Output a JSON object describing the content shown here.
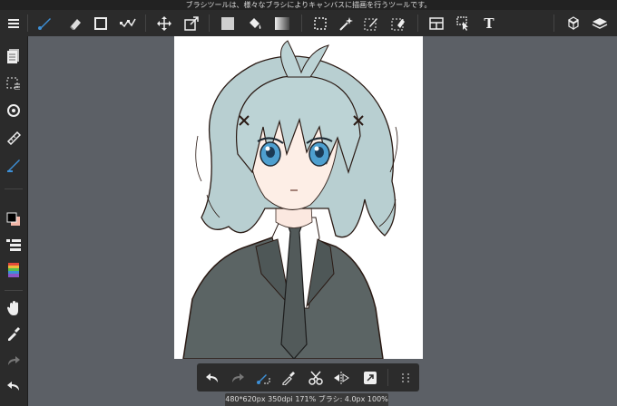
{
  "hint": {
    "text": "ブラシツールは、様々なブラシによりキャンバスに描画を行うツールです。"
  },
  "toolbar": {
    "tools": [
      {
        "name": "menu-icon",
        "selected": false
      },
      {
        "name": "brush-tool-icon",
        "selected": true
      },
      {
        "name": "eraser-tool-icon",
        "selected": false
      },
      {
        "name": "shape-tool-icon",
        "selected": false
      },
      {
        "name": "edit-tool-icon",
        "selected": false
      },
      {
        "name": "move-tool-icon",
        "selected": false
      },
      {
        "name": "transform-tool-icon",
        "selected": false
      },
      {
        "name": "fill-color-icon",
        "selected": false
      },
      {
        "name": "bucket-tool-icon",
        "selected": false
      },
      {
        "name": "gradient-tool-icon",
        "selected": false
      },
      {
        "name": "select-tool-icon",
        "selected": false
      },
      {
        "name": "magic-wand-icon",
        "selected": false
      },
      {
        "name": "select-pen-icon",
        "selected": false
      },
      {
        "name": "select-eraser-icon",
        "selected": false
      },
      {
        "name": "frame-divide-icon",
        "selected": false
      },
      {
        "name": "operation-tool-icon",
        "selected": false
      },
      {
        "name": "text-tool-icon",
        "selected": false
      },
      {
        "name": "material-icon",
        "selected": false
      },
      {
        "name": "layers-icon",
        "selected": false
      }
    ],
    "text_tool_label": "T"
  },
  "sidebar": {
    "items": [
      {
        "name": "page-manager-icon"
      },
      {
        "name": "selection-layer-icon"
      },
      {
        "name": "snap-icon"
      },
      {
        "name": "ruler-icon"
      },
      {
        "name": "brush-settings-icon"
      },
      {
        "name": "color-swatch-icon"
      },
      {
        "name": "layer-property-icon"
      },
      {
        "name": "color-palette-icon"
      },
      {
        "name": "hand-tool-icon"
      },
      {
        "name": "eyedropper-icon"
      },
      {
        "name": "redo-icon"
      },
      {
        "name": "undo-icon"
      }
    ],
    "colors": {
      "primary": "#000000",
      "secondary": "#f4b7a8",
      "accent": "#3d8fd6"
    }
  },
  "canvas": {
    "background": "#5c6066",
    "paper_color": "#ffffff",
    "artwork": "anime-character-sketch"
  },
  "quickbar": {
    "items": [
      {
        "name": "undo-icon"
      },
      {
        "name": "redo-icon"
      },
      {
        "name": "brush-snap-icon"
      },
      {
        "name": "eyedropper-icon"
      },
      {
        "name": "cut-icon"
      },
      {
        "name": "flip-icon"
      },
      {
        "name": "transform-icon"
      },
      {
        "name": "more-grid-icon"
      }
    ]
  },
  "status": {
    "text": "480*620px 350dpi 171% ブラシ: 4.0px 100%"
  }
}
